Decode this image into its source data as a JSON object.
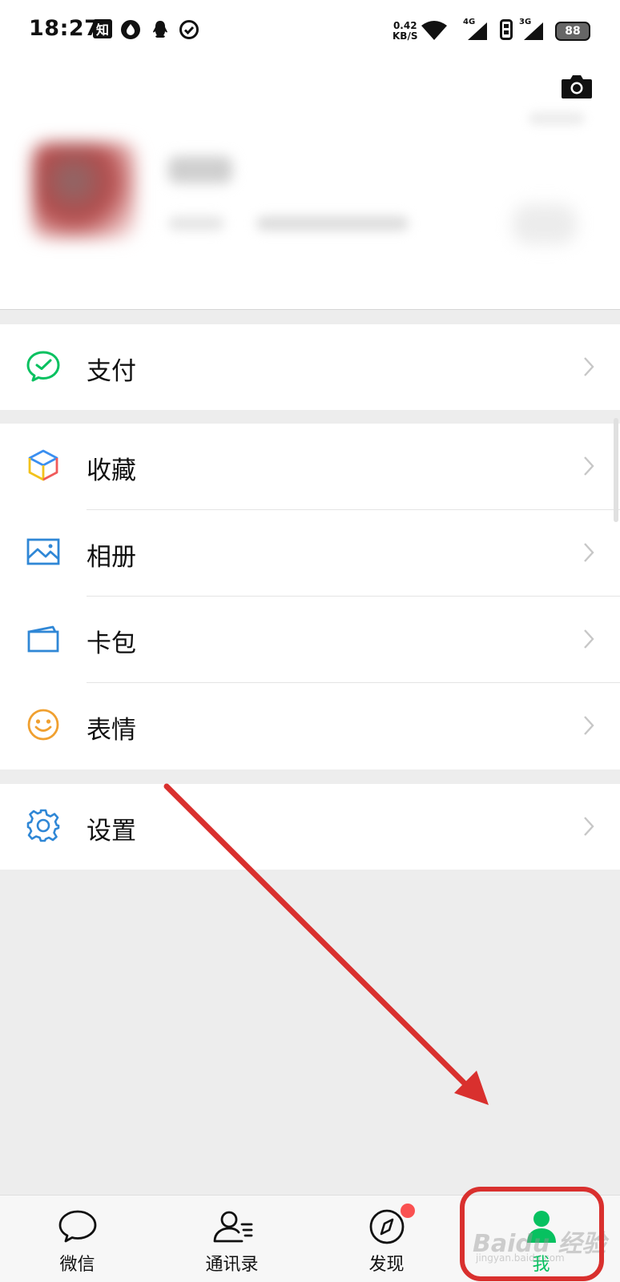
{
  "status_bar": {
    "time": "18:27",
    "zhihu_badge": "知",
    "net_speed_value": "0.42",
    "net_speed_unit": "KB/S",
    "signal_1": "4G",
    "signal_2": "3G",
    "battery_level": "88"
  },
  "menu": {
    "pay": {
      "label": "支付",
      "icon": "wechat-pay-icon"
    },
    "favorites": {
      "label": "收藏",
      "icon": "cube-icon"
    },
    "album": {
      "label": "相册",
      "icon": "image-icon"
    },
    "cards": {
      "label": "卡包",
      "icon": "card-wallet-icon"
    },
    "stickers": {
      "label": "表情",
      "icon": "smiley-icon"
    },
    "settings": {
      "label": "设置",
      "icon": "gear-icon"
    }
  },
  "tabbar": {
    "chats": "微信",
    "contacts": "通讯录",
    "discover": "发现",
    "me": "我"
  },
  "watermark": {
    "main": "Baidu 经验",
    "sub": "jingyan.baidu.com"
  },
  "colors": {
    "accent": "#07c160",
    "annotation": "#d9302e",
    "badge": "#fa5151",
    "page_bg": "#ededed"
  }
}
